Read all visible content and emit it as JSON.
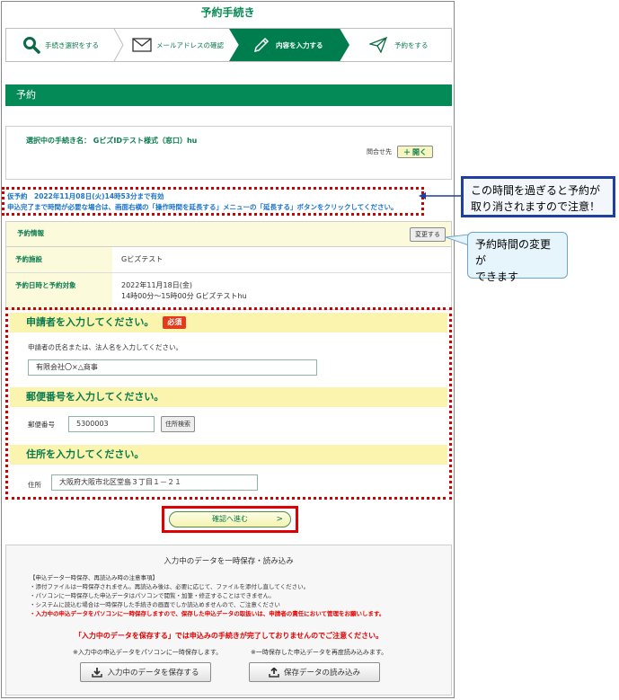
{
  "page": {
    "title": "予約手続き"
  },
  "steps": [
    {
      "label": "手続き選択をする",
      "icon": "search-icon",
      "active": false
    },
    {
      "label": "メールアドレスの確認",
      "icon": "mail-icon",
      "active": false
    },
    {
      "label": "内容を入力する",
      "icon": "pencil-icon",
      "active": true
    },
    {
      "label": "予約をする",
      "icon": "send-icon",
      "active": false
    }
  ],
  "section": {
    "title": "予約"
  },
  "procedure": {
    "name": "選択中の手続き名： GビズIDテスト様式（窓口）hu",
    "inquiry_label": "問合せ先",
    "open_label": "開く"
  },
  "notice": {
    "line1": "仮予約　2022年11月08日(火)14時53分まで有効",
    "line2": "申込完了まで時間が必要な場合は、画面右横の「操作時間を延長する」メニューの「延長する」ボタンをクリックしてください。"
  },
  "reservation": {
    "header": "予約情報",
    "change_label": "変更する",
    "rows": [
      {
        "key": "予約施設",
        "value": "Gビズテスト",
        "value2": ""
      },
      {
        "key": "予約日時と予約対象",
        "value": "2022年11月18日(金)",
        "value2": "14時00分～15時00分 Gビズテストhu"
      }
    ]
  },
  "applicant": {
    "heading": "申請者を入力してください。",
    "required": "必須",
    "help": "申請者の氏名または、法人名を入力してください。",
    "value": "有限会社〇×△商事"
  },
  "postal": {
    "heading": "郵便番号を入力してください。",
    "label": "郵便番号",
    "value": "5300003",
    "search_label": "住所検索"
  },
  "address": {
    "heading": "住所を入力してください。",
    "label": "住所",
    "value": "大阪府大阪市北区堂島３丁目１－２１"
  },
  "confirm": {
    "label": "確認へ進む",
    "arrow": ">"
  },
  "save": {
    "title": "入力中のデータを一時保存・読み込み",
    "notes_title": "【申込データ一時保存、再読込み時の注意事項】",
    "notes": [
      "・添付ファイルは一時保存されません。再読込み後は、必要に応じて、ファイルを添付し直してください。",
      "・パソコンに一時保存した申込データはパソコンで閲覧・加筆・修正することはできません。",
      "・システムに読込む場合は一時保存した手続きの画面でしか読込めませんので、ご注意ください"
    ],
    "red_note": "・入力中の申込データをパソコンに一時保存しますので、保存した申込データの取扱いは、申請者の責任において管理をお願いします。",
    "warning": "「入力中のデータを保存する」では申込みの手続きが完了しておりませんのでご注意ください。",
    "save_note": "※入力中の申込データをパソコンに一時保存します。",
    "load_note": "※一時保存した申込データを再度読み込みます。",
    "save_button": "入力中のデータを保存する",
    "load_button": "保存データの読み込み"
  },
  "callouts": {
    "first_line1": "この時間を過ぎると予約が",
    "first_line2": "取り消されますので注意！",
    "second_line1": "予約時間の変更が",
    "second_line2": "できます"
  },
  "colors": {
    "accent": "#038a57",
    "required": "#e23b1e",
    "alert": "#e00000",
    "link": "#1a73c8"
  }
}
